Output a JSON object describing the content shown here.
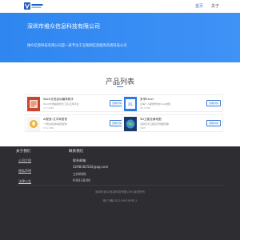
{
  "header": {
    "nav": [
      {
        "label": "首页"
      },
      {
        "label": "关于"
      }
    ]
  },
  "hero": {
    "title": "深圳市维众信息科技有限公司",
    "description": "维众信息科技有限公司是一家专注于互联网信息服务的高科技公司"
  },
  "products": {
    "title": "产品列表",
    "items": [
      {
        "name": "Word文档自动编排助手",
        "sub": "Word文档编辑优化工具 应用平台",
        "size": "17.33MB",
        "button": "查看详情",
        "thumb_color": "#c9452f"
      },
      {
        "name": "多学Excel",
        "sub": "让每个人都能学会Excel技能",
        "size": "56.47MB",
        "button": "查看详情",
        "thumb_color": "#2d7ae0"
      },
      {
        "name": "AI配音-文字转语音",
        "sub": "一键生成多种语音配音",
        "size": "53.15MB",
        "button": "查看详情",
        "thumb_color": "#f5f5f5"
      },
      {
        "name": "3D卫星全景地图",
        "sub": "全球高清卫星实景地图查看",
        "size": "4MB",
        "button": "查看详情",
        "thumb_color": "#1b3a6a"
      }
    ]
  },
  "footer": {
    "about": {
      "heading": "关于我们",
      "links": [
        "公司介绍",
        "隐私声明",
        "法律公告"
      ]
    },
    "contact": {
      "heading": "联系我们",
      "email_label": "联系邮箱:",
      "email": "3298182562@qq.com",
      "hours_label": "工作时间:",
      "hours": "9:00-18:00"
    },
    "copyright": "深圳市维众信息科技有限公司 版权所有",
    "icp": "粤ICP备2022046208号-2"
  }
}
